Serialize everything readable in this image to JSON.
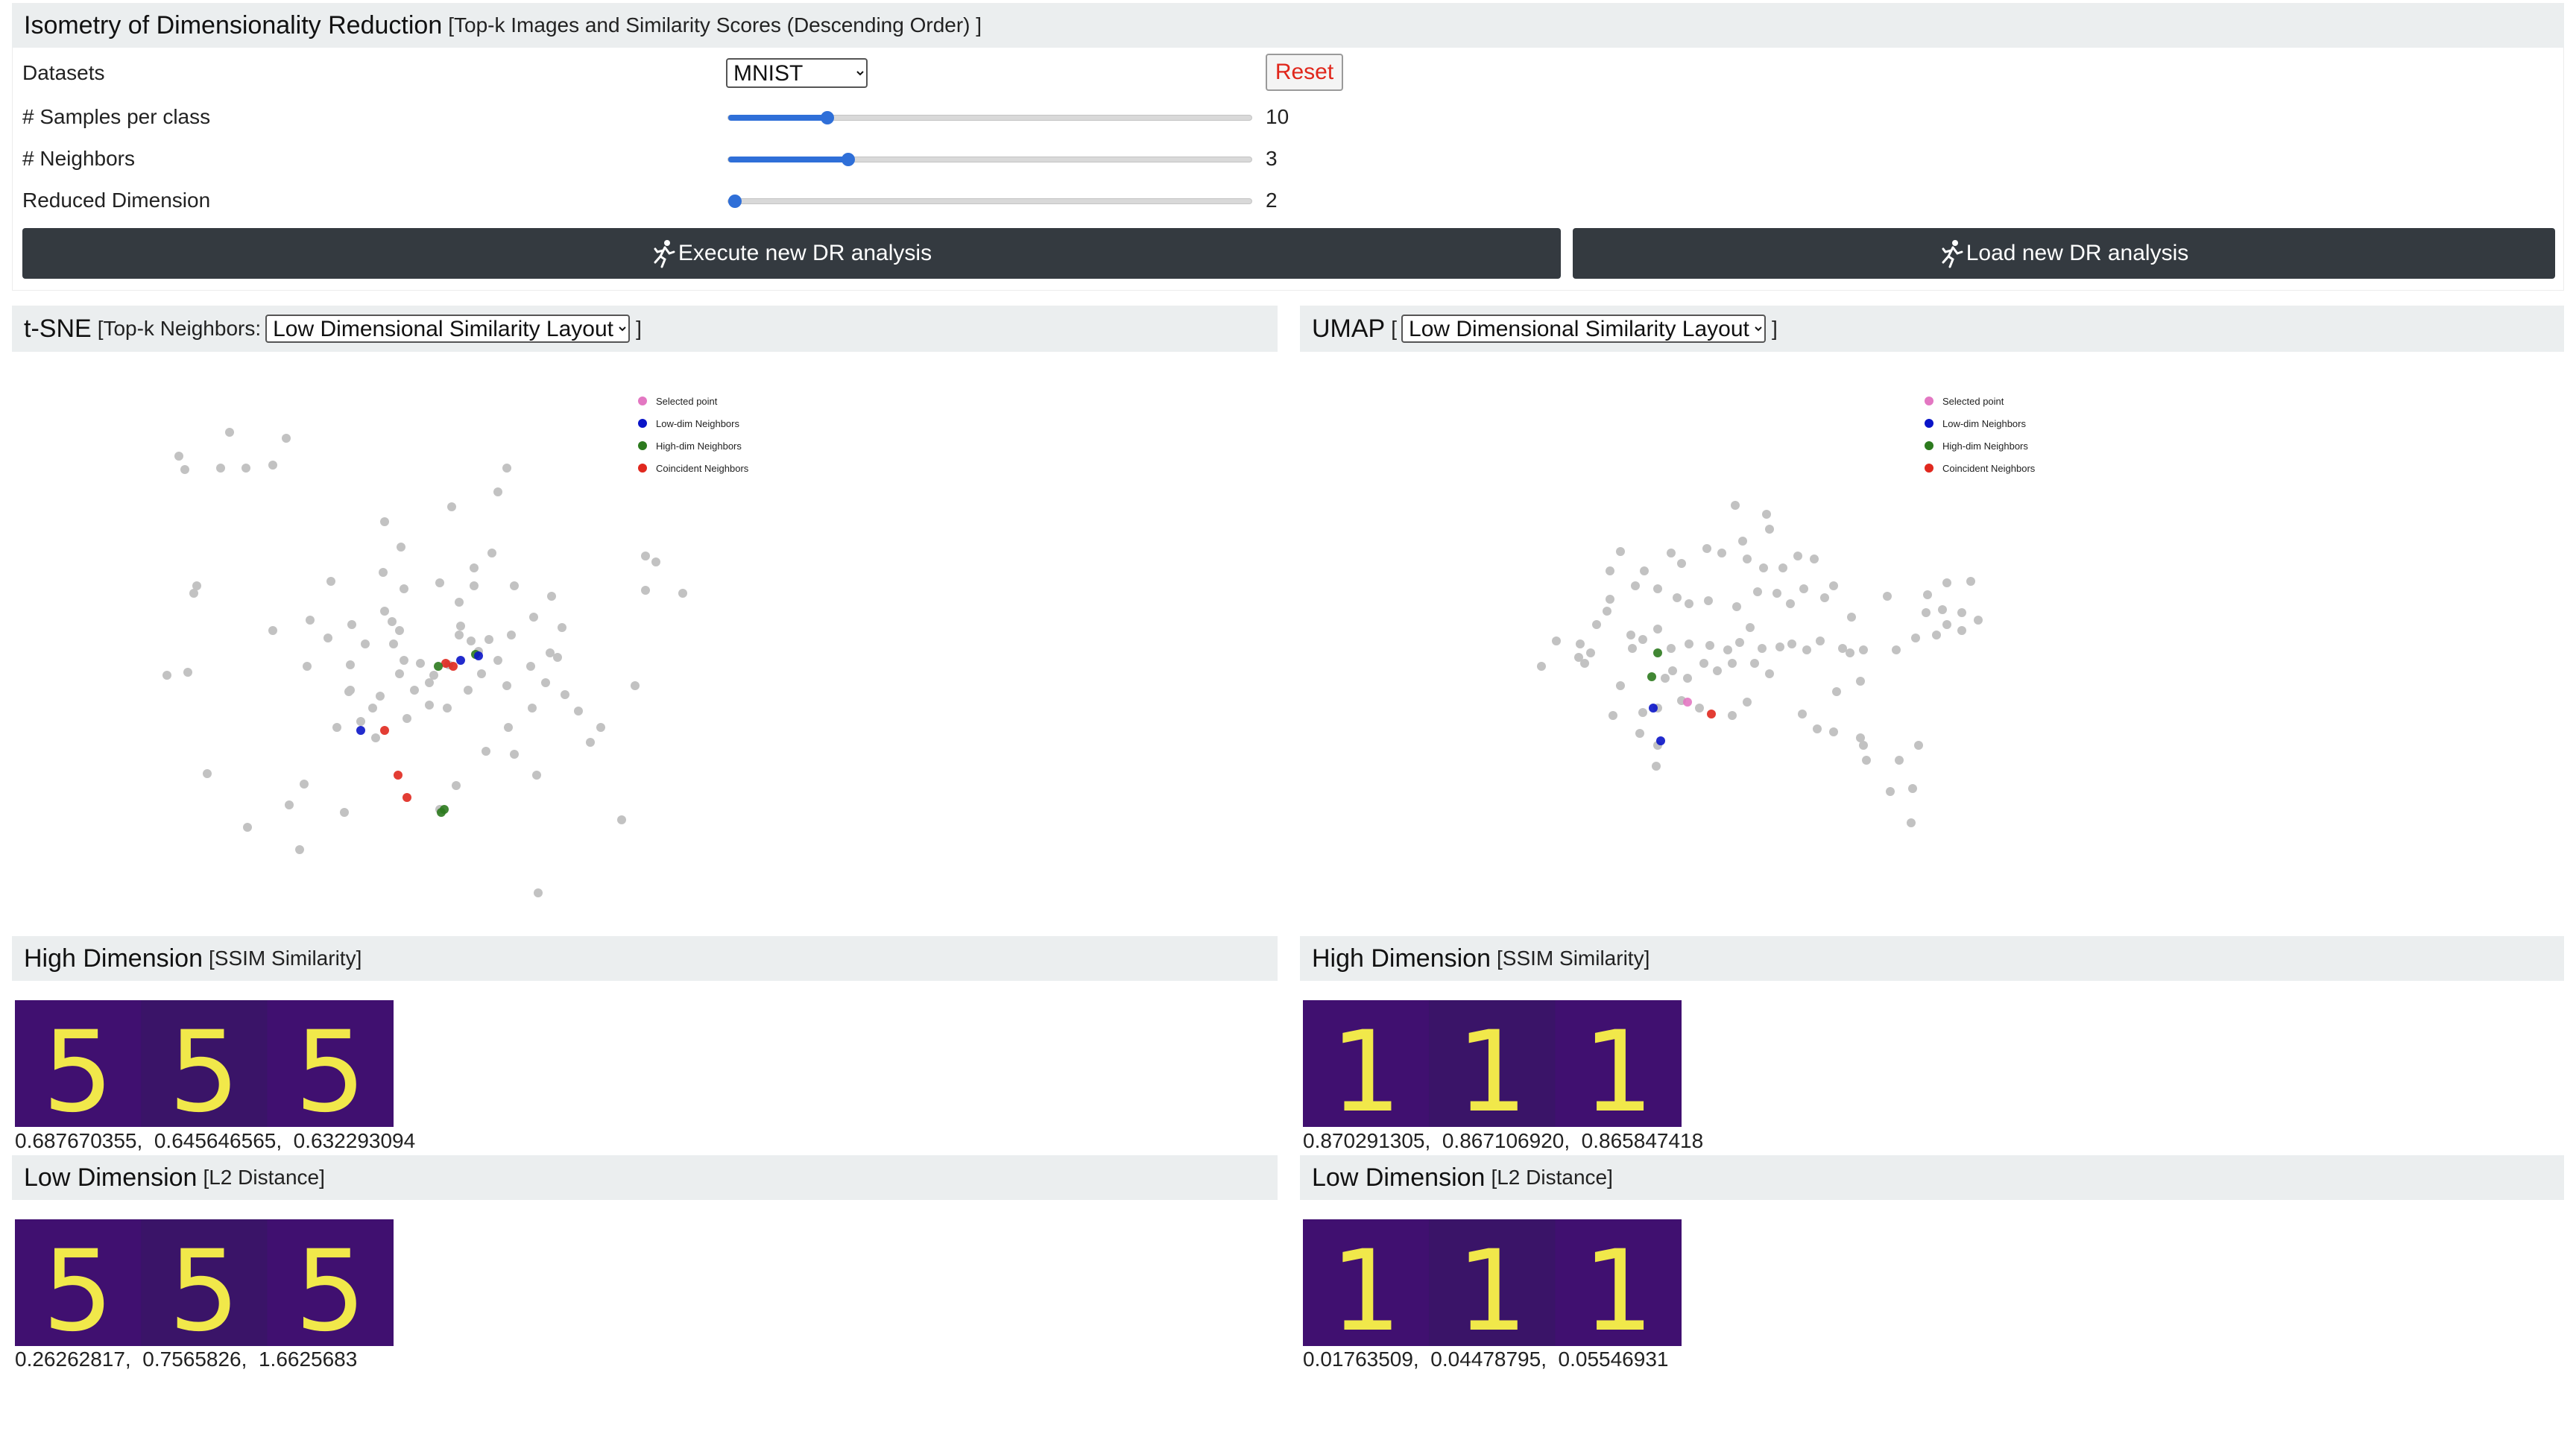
{
  "header": {
    "title": "Isometry of Dimensionality Reduction",
    "subtitle": "[Top-k Images and Similarity Scores (Descending Order) ]"
  },
  "controls": {
    "datasets_label": "Datasets",
    "dataset_value": "MNIST",
    "reset_label": "Reset",
    "samples_label": "# Samples per class",
    "samples_value": "10",
    "samples_fraction": 0.19,
    "neighbors_label": "# Neighbors",
    "neighbors_value": "3",
    "neighbors_fraction": 0.23,
    "reduced_dim_label": "Reduced Dimension",
    "reduced_dim_value": "2",
    "reduced_dim_fraction": 0.0,
    "execute_label": "Execute new DR analysis",
    "load_label": "Load new DR analysis"
  },
  "tsne": {
    "title": "t-SNE",
    "sub_prefix": "[Top-k Neighbors:",
    "layout_value": "Low Dimensional Similarity Layout",
    "sub_suffix": "]",
    "high_title": "High Dimension",
    "high_sub": "[SSIM Similarity]",
    "high_scores": "0.687670355,  0.645646565,  0.632293094",
    "high_digits": [
      "5",
      "5",
      "5"
    ],
    "low_title": "Low Dimension",
    "low_sub": "[L2 Distance]",
    "low_scores": "0.26262817,  0.7565826,  1.6625683",
    "low_digits": [
      "5",
      "5",
      "5"
    ]
  },
  "umap": {
    "title": "UMAP",
    "sub_prefix": "[",
    "layout_value": "Low Dimensional Similarity Layout",
    "sub_suffix": "]",
    "high_title": "High Dimension",
    "high_sub": "[SSIM Similarity]",
    "high_scores": "0.870291305,  0.867106920,  0.865847418",
    "high_digits": [
      "1",
      "1",
      "1"
    ],
    "low_title": "Low Dimension",
    "low_sub": "[L2 Distance]",
    "low_scores": "0.01763509,  0.04478795,  0.05546931",
    "low_digits": [
      "1",
      "1",
      "1"
    ]
  },
  "legend": [
    {
      "label": "Selected point",
      "color": "#e377c2"
    },
    {
      "label": "Low-dim Neighbors",
      "color": "#0a14c8"
    },
    {
      "label": "High-dim Neighbors",
      "color": "#2c7a1e"
    },
    {
      "label": "Coincident Neighbors",
      "color": "#e0281e"
    }
  ],
  "colors": {
    "point": "#c2c2c2",
    "header_bg": "#ebeeef",
    "button_bg": "#343a40",
    "slider_accent": "#2f6fd8",
    "image_bg": "#3b0f70",
    "digit_color": "#f1e84a"
  }
}
